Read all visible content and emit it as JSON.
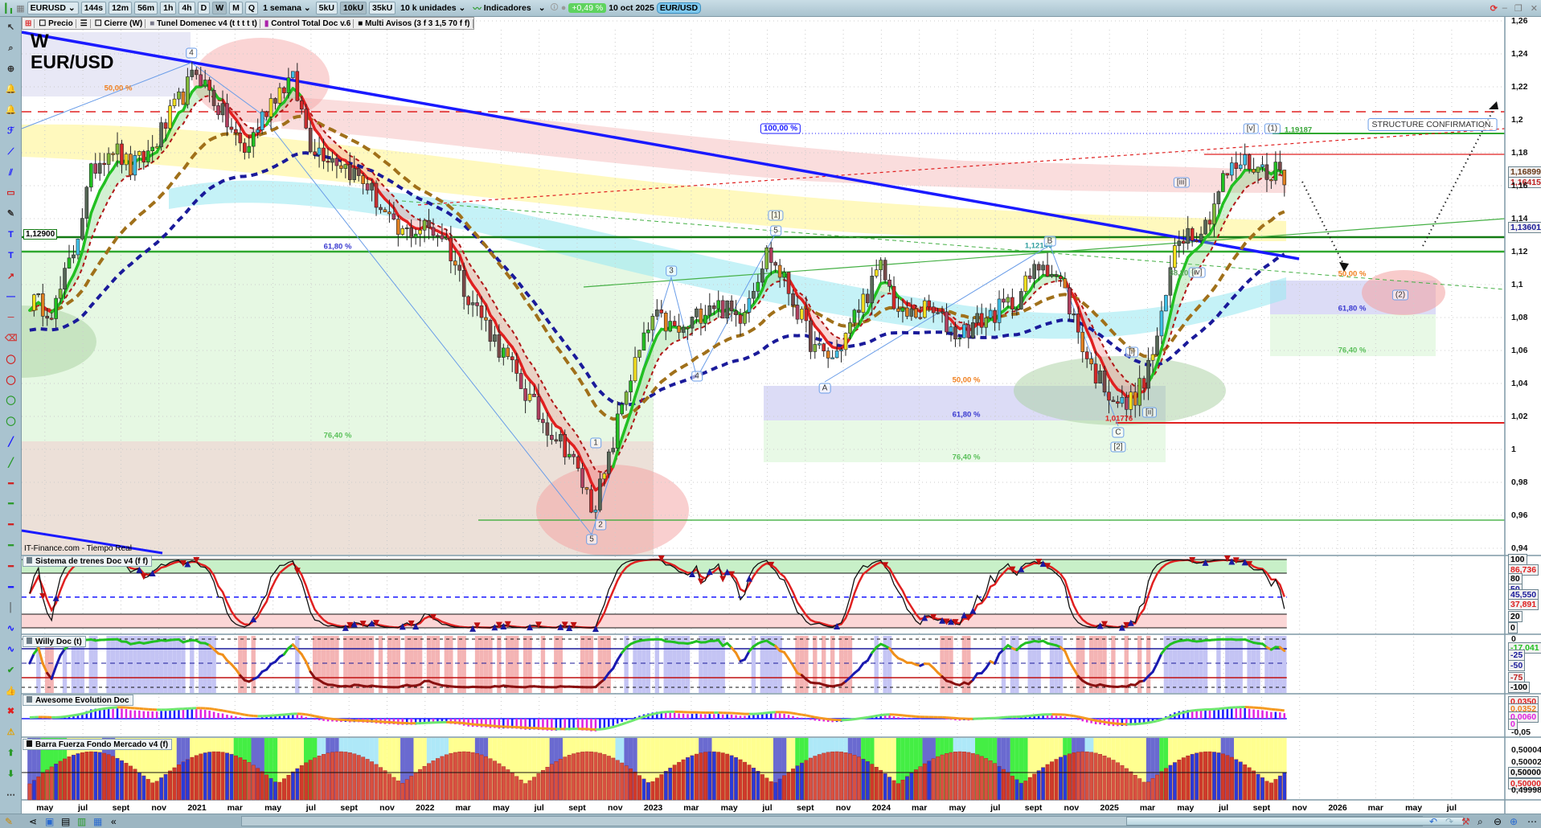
{
  "toolbar": {
    "symbol": "EURUSD",
    "intervals": [
      "144s",
      "12m",
      "56m",
      "1h",
      "4h",
      "D",
      "W",
      "M",
      "Q"
    ],
    "active_interval": "W",
    "period": "1 semana",
    "units": [
      "5kU",
      "10kU",
      "35kU"
    ],
    "active_unit": "10kU",
    "units_select": "10 k unidades",
    "indicators": "Indicadores",
    "change_pct": "+0,49 %",
    "date": "10 oct 2025",
    "pair": "EUR/USD"
  },
  "legend": {
    "items": [
      "Precio",
      "Cierre (W)",
      "Tunel Domenec v4 (t t t t t)",
      "Control Total Doc v.6",
      "Multi Avisos (3 f 3 1,5 70 f f)"
    ]
  },
  "chart_title": {
    "wave": "W",
    "symbol": "EUR/USD"
  },
  "source": "IT-Finance.com - Tiempo Real",
  "annotations": {
    "structure": "STRUCTURE CONFIRMATION.",
    "hundred": "100,00 %",
    "level_left": "1,12900",
    "level_b": "1,12140",
    "level_low": "1,01776",
    "level_high": "1,19187",
    "fib382": "38,20 %",
    "fib_left": [
      "50,00 %",
      "61,80 %",
      "76,40 %"
    ],
    "fib_mid": [
      "50,00 %",
      "61,80 %",
      "76,40 %"
    ],
    "fib_right": [
      "50,00 %",
      "61,80 %",
      "76,40 %"
    ],
    "waves": [
      "4",
      "3",
      "4",
      "1",
      "2",
      "5",
      "[1]",
      "5",
      "A",
      "B",
      "C",
      "[2]",
      "[i]",
      "[ii]",
      "[iii]",
      "[iv]",
      "[v]",
      "(1)",
      "(2)"
    ]
  },
  "price_axis": {
    "ticks": [
      "1,26",
      "1,24",
      "1,22",
      "1,2",
      "1,18",
      "1,16",
      "1,14",
      "1,12",
      "1,1",
      "1,08",
      "1,06",
      "1,04",
      "1,02",
      "1",
      "0,98",
      "0,96",
      "0,94"
    ],
    "last_price": "1,16899",
    "ma_price": "1,16415",
    "ma_slow": "1,13601"
  },
  "panels": {
    "trenes": {
      "title": "Sistema de trenes Doc v4 (f f)",
      "ticks": [
        "100",
        "80",
        "50",
        "20",
        "0"
      ],
      "val1": "86,736",
      "val2": "45,550",
      "val3": "37,891"
    },
    "willy": {
      "title": "Willy Doc (t)",
      "ticks": [
        "0",
        "-25",
        "-50",
        "-75",
        "-100"
      ],
      "val": "-17,041"
    },
    "awesome": {
      "title": "Awesome Evolution Doc",
      "vals": [
        "0,0350",
        "0,0352",
        "0,0060",
        "0"
      ],
      "tick": "-0,05"
    },
    "barra": {
      "title": "Barra Fuerza Fondo Mercado v4 (f)",
      "ticks": [
        "0,50004",
        "0,50002",
        "0,50000",
        "0,49998"
      ],
      "val": "0,50000"
    }
  },
  "colors": {
    "up": "#5b6b5a",
    "down": "#d62828",
    "accent": "#1a1aff",
    "green": "#22b822",
    "navy": "#1a1a9a"
  },
  "chart_data": {
    "type": "candlestick",
    "title": "EUR/USD",
    "timeframe": "1 semana",
    "ylim": [
      0.94,
      1.26
    ],
    "x_labels": [
      {
        "m": -8,
        "t": "may"
      },
      {
        "m": -6,
        "t": "jul"
      },
      {
        "m": -4,
        "t": "sept"
      },
      {
        "m": -2,
        "t": "nov"
      },
      {
        "m": 0,
        "t": "2021"
      },
      {
        "m": 2,
        "t": "mar"
      },
      {
        "m": 4,
        "t": "may"
      },
      {
        "m": 6,
        "t": "jul"
      },
      {
        "m": 8,
        "t": "sept"
      },
      {
        "m": 10,
        "t": "nov"
      },
      {
        "m": 12,
        "t": "2022"
      },
      {
        "m": 14,
        "t": "mar"
      },
      {
        "m": 16,
        "t": "may"
      },
      {
        "m": 18,
        "t": "jul"
      },
      {
        "m": 20,
        "t": "sept"
      },
      {
        "m": 22,
        "t": "nov"
      },
      {
        "m": 24,
        "t": "2023"
      },
      {
        "m": 26,
        "t": "mar"
      },
      {
        "m": 28,
        "t": "may"
      },
      {
        "m": 30,
        "t": "jul"
      },
      {
        "m": 32,
        "t": "sept"
      },
      {
        "m": 34,
        "t": "nov"
      },
      {
        "m": 36,
        "t": "2024"
      },
      {
        "m": 38,
        "t": "mar"
      },
      {
        "m": 40,
        "t": "may"
      },
      {
        "m": 42,
        "t": "jul"
      },
      {
        "m": 44,
        "t": "sept"
      },
      {
        "m": 46,
        "t": "nov"
      },
      {
        "m": 48,
        "t": "2025"
      },
      {
        "m": 50,
        "t": "mar"
      },
      {
        "m": 52,
        "t": "may"
      },
      {
        "m": 54,
        "t": "jul"
      },
      {
        "m": 56,
        "t": "sept"
      },
      {
        "m": 58,
        "t": "nov"
      },
      {
        "m": 60,
        "t": "2026"
      },
      {
        "m": 62,
        "t": "mar"
      },
      {
        "m": 64,
        "t": "may"
      },
      {
        "m": 66,
        "t": "jul"
      }
    ],
    "price_keypoints": [
      [
        -8.8,
        1.09
      ],
      [
        -7.5,
        1.085
      ],
      [
        -6.5,
        1.12
      ],
      [
        -5.5,
        1.17
      ],
      [
        -4.5,
        1.185
      ],
      [
        -3.5,
        1.17
      ],
      [
        -2.5,
        1.18
      ],
      [
        -1,
        1.21
      ],
      [
        0,
        1.23
      ],
      [
        1,
        1.21
      ],
      [
        2.5,
        1.18
      ],
      [
        4,
        1.215
      ],
      [
        5,
        1.225
      ],
      [
        6,
        1.185
      ],
      [
        7.5,
        1.175
      ],
      [
        9,
        1.16
      ],
      [
        10.5,
        1.13
      ],
      [
        12,
        1.135
      ],
      [
        13,
        1.13
      ],
      [
        14,
        1.1
      ],
      [
        15.5,
        1.07
      ],
      [
        16.5,
        1.05
      ],
      [
        18,
        1.02
      ],
      [
        19.5,
        1.0
      ],
      [
        20.8,
        0.965
      ],
      [
        21.5,
        0.985
      ],
      [
        22.5,
        1.035
      ],
      [
        24,
        1.08
      ],
      [
        25.5,
        1.07
      ],
      [
        27,
        1.09
      ],
      [
        28.5,
        1.08
      ],
      [
        30,
        1.12
      ],
      [
        31,
        1.1
      ],
      [
        32.5,
        1.06
      ],
      [
        33.5,
        1.055
      ],
      [
        35,
        1.09
      ],
      [
        36,
        1.11
      ],
      [
        37,
        1.08
      ],
      [
        38.5,
        1.085
      ],
      [
        40,
        1.07
      ],
      [
        41.5,
        1.08
      ],
      [
        43,
        1.09
      ],
      [
        44.5,
        1.115
      ],
      [
        45.5,
        1.1
      ],
      [
        47,
        1.05
      ],
      [
        48,
        1.035
      ],
      [
        48.8,
        1.025
      ],
      [
        49.8,
        1.04
      ],
      [
        50.8,
        1.08
      ],
      [
        51.5,
        1.13
      ],
      [
        53,
        1.135
      ],
      [
        54,
        1.165
      ],
      [
        55,
        1.175
      ],
      [
        56,
        1.17
      ],
      [
        57.3,
        1.169
      ]
    ],
    "series": [
      "EMA fast",
      "EMA signal",
      "EMA medium",
      "EMA slow"
    ]
  }
}
